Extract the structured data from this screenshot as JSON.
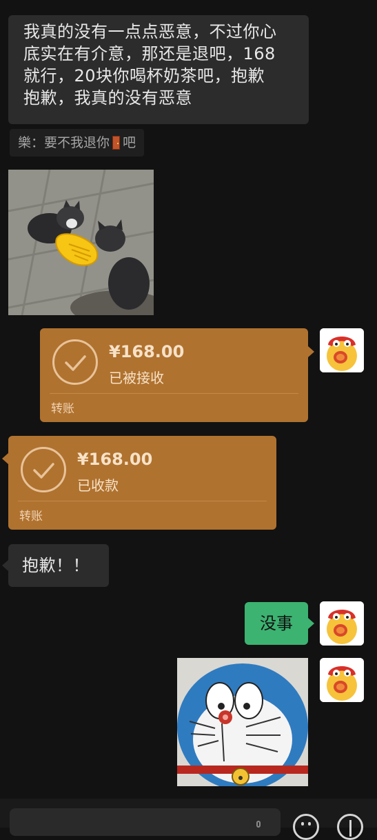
{
  "messages": {
    "msg1": {
      "line1": "我真的没有一点点恶意，不过你心",
      "line2": "底实在有介意，那还是退吧，168",
      "line3": "就行，20块你喝杯奶茶吧，抱歉",
      "line4": "抱歉，我真的没有恶意"
    },
    "quote": {
      "prefix": "樂：要不我退你",
      "suffix": "吧"
    },
    "sticker_cats": "cats-handshake-sticker",
    "transfer_sent": {
      "amount": "¥168.00",
      "status": "已被接收",
      "label": "转账"
    },
    "transfer_received": {
      "amount": "¥168.00",
      "status": "已收款",
      "label": "转账"
    },
    "msg_apology": "抱歉！！",
    "msg_reply": "没事",
    "sticker_doraemon": "doraemon-sticker"
  },
  "colors": {
    "background": "#121212",
    "gray_bubble": "#2c2c2c",
    "transfer": "#b0722f",
    "green_bubble": "#3cb371"
  }
}
